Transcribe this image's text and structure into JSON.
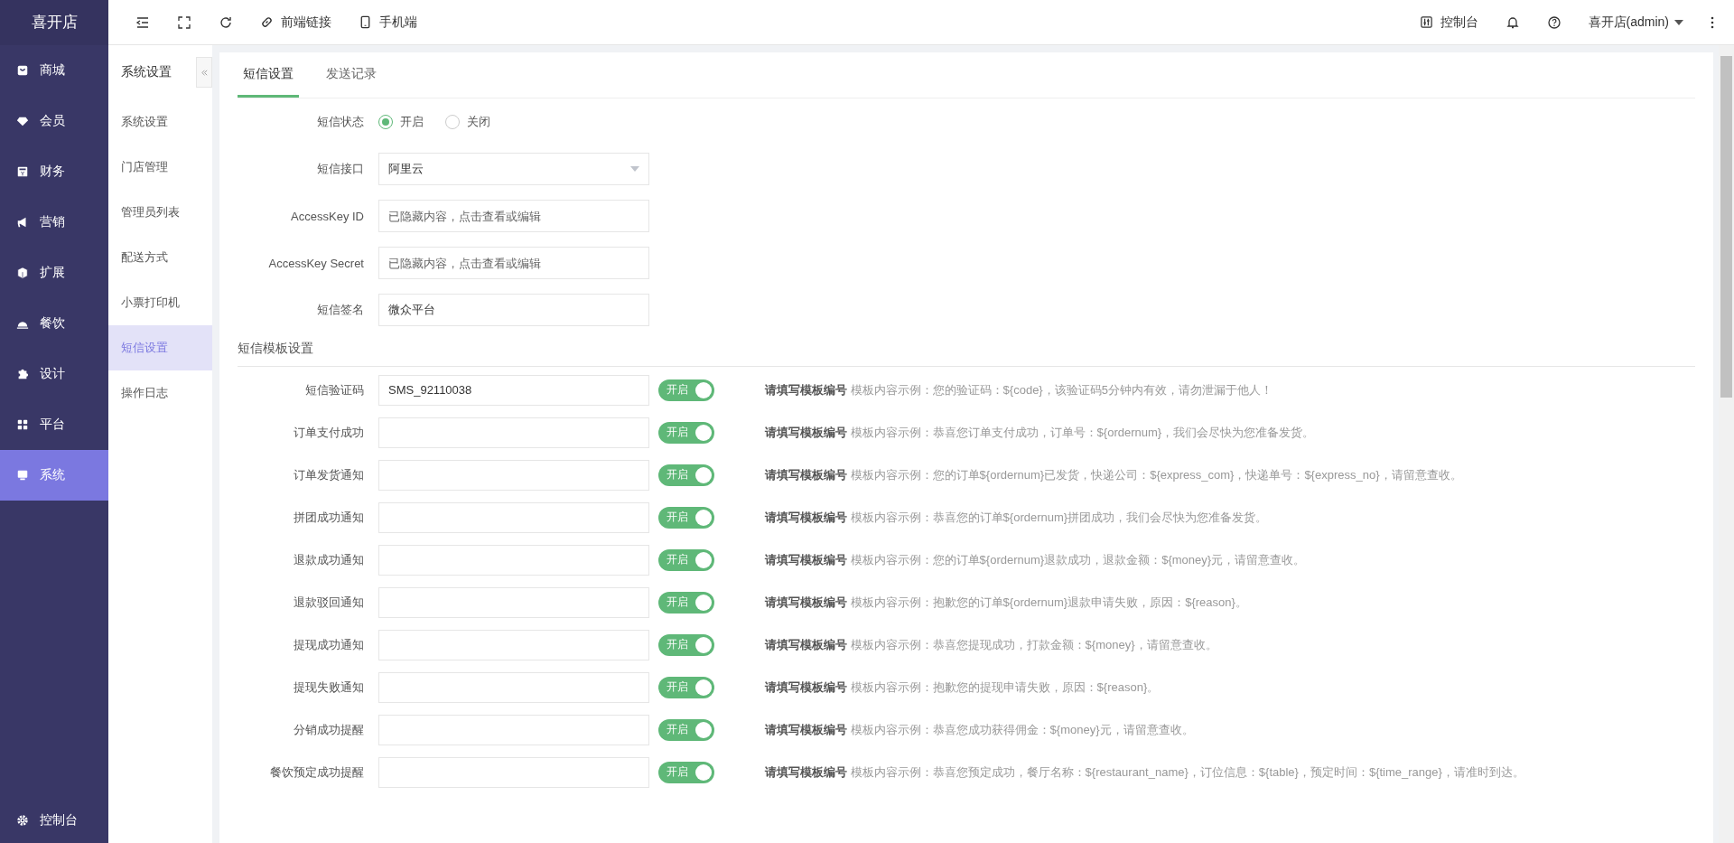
{
  "brand": "喜开店",
  "sidebar": {
    "items": [
      {
        "label": "商城",
        "selected": false
      },
      {
        "label": "会员",
        "selected": false
      },
      {
        "label": "财务",
        "selected": false
      },
      {
        "label": "营销",
        "selected": false
      },
      {
        "label": "扩展",
        "selected": false
      },
      {
        "label": "餐饮",
        "selected": false
      },
      {
        "label": "设计",
        "selected": false
      },
      {
        "label": "平台",
        "selected": false
      },
      {
        "label": "系统",
        "selected": true
      }
    ],
    "footer": {
      "label": "控制台"
    }
  },
  "header": {
    "links": [
      {
        "label": "前端链接"
      },
      {
        "label": "手机端"
      }
    ],
    "console": "控制台",
    "user": "喜开店(admin)"
  },
  "subnav": {
    "title": "系统设置",
    "items": [
      {
        "label": "系统设置",
        "selected": false
      },
      {
        "label": "门店管理",
        "selected": false
      },
      {
        "label": "管理员列表",
        "selected": false
      },
      {
        "label": "配送方式",
        "selected": false
      },
      {
        "label": "小票打印机",
        "selected": false
      },
      {
        "label": "短信设置",
        "selected": true
      },
      {
        "label": "操作日志",
        "selected": false
      }
    ]
  },
  "tabs": [
    {
      "label": "短信设置",
      "selected": true
    },
    {
      "label": "发送记录",
      "selected": false
    }
  ],
  "form": {
    "status": {
      "label": "短信状态",
      "options": [
        {
          "label": "开启",
          "selected": true
        },
        {
          "label": "关闭",
          "selected": false
        }
      ]
    },
    "fields": [
      {
        "kind": "select",
        "label": "短信接口",
        "value": "阿里云"
      },
      {
        "kind": "input",
        "label": "AccessKey ID",
        "placeholder": "已隐藏内容，点击查看或编辑"
      },
      {
        "kind": "input",
        "label": "AccessKey Secret",
        "placeholder": "已隐藏内容，点击查看或编辑"
      },
      {
        "kind": "input",
        "label": "短信签名",
        "value": "微众平台"
      }
    ]
  },
  "template_section": {
    "title": "短信模板设置",
    "rows": [
      {
        "label": "短信验证码",
        "value": "SMS_92110038",
        "toggle": {
          "label": "开启",
          "on": true
        },
        "hint": "**请填写模板编号** 模板内容示例：您的验证码：${code}，该验证码5分钟内有效，请勿泄漏于他人！"
      },
      {
        "label": "订单支付成功",
        "toggle": {
          "label": "开启",
          "on": true
        },
        "hint": "**请填写模板编号** 模板内容示例：恭喜您订单支付成功，订单号：${ordernum}，我们会尽快为您准备发货。"
      },
      {
        "label": "订单发货通知",
        "toggle": {
          "label": "开启",
          "on": true
        },
        "hint": "**请填写模板编号** 模板内容示例：您的订单${ordernum}已发货，快递公司：${express_com}，快递单号：${express_no}，请留意查收。"
      },
      {
        "label": "拼团成功通知",
        "toggle": {
          "label": "开启",
          "on": true
        },
        "hint": "**请填写模板编号** 模板内容示例：恭喜您的订单${ordernum}拼团成功，我们会尽快为您准备发货。"
      },
      {
        "label": "退款成功通知",
        "toggle": {
          "label": "开启",
          "on": true
        },
        "hint": "**请填写模板编号** 模板内容示例：您的订单${ordernum}退款成功，退款金额：${money}元，请留意查收。"
      },
      {
        "label": "退款驳回通知",
        "toggle": {
          "label": "开启",
          "on": true
        },
        "hint": "**请填写模板编号** 模板内容示例：抱歉您的订单${ordernum}退款申请失败，原因：${reason}。"
      },
      {
        "label": "提现成功通知",
        "toggle": {
          "label": "开启",
          "on": true
        },
        "hint": "**请填写模板编号** 模板内容示例：恭喜您提现成功，打款金额：${money}，请留意查收。"
      },
      {
        "label": "提现失败通知",
        "toggle": {
          "label": "开启",
          "on": true
        },
        "hint": "**请填写模板编号** 模板内容示例：抱歉您的提现申请失败，原因：${reason}。"
      },
      {
        "label": "分销成功提醒",
        "toggle": {
          "label": "开启",
          "on": true
        },
        "hint": "**请填写模板编号** 模板内容示例：恭喜您成功获得佣金：${money}元，请留意查收。"
      },
      {
        "label": "餐饮预定成功提醒",
        "toggle": {
          "label": "开启",
          "on": true
        },
        "hint": "**请填写模板编号** 模板内容示例：恭喜您预定成功，餐厅名称：${restaurant_name}，订位信息：${table}，预定时间：${time_range}，请准时到达。"
      }
    ]
  }
}
